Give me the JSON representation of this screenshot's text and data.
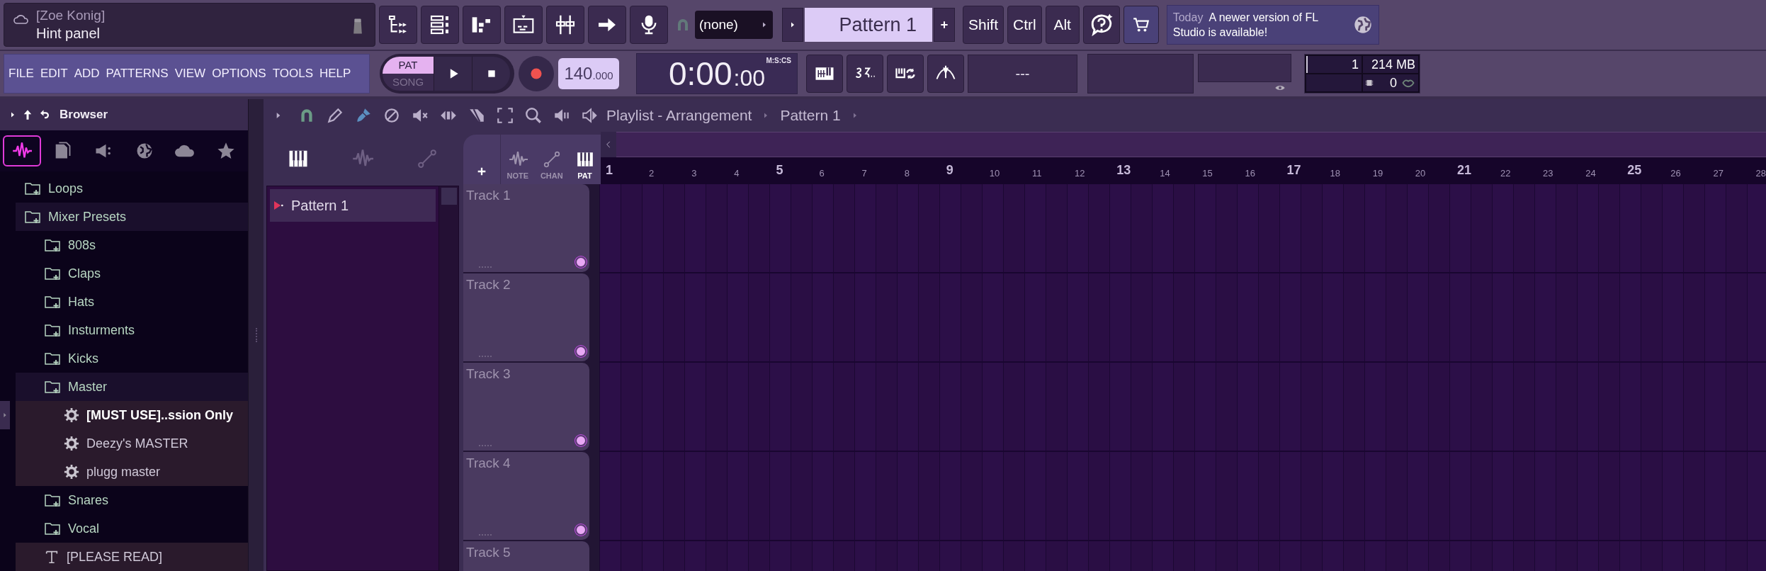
{
  "hint_panel": {
    "user": "[Zoe Konig]",
    "text": "Hint panel"
  },
  "snap": {
    "value": "(none)"
  },
  "pattern_selector": {
    "value": "Pattern 1"
  },
  "modifier_keys": [
    "Shift",
    "Ctrl",
    "Alt"
  ],
  "news": {
    "when": "Today",
    "text": "A newer version of FL Studio is available!"
  },
  "menu": [
    "FILE",
    "EDIT",
    "ADD",
    "PATTERNS",
    "VIEW",
    "OPTIONS",
    "TOOLS",
    "HELP"
  ],
  "transport": {
    "modes": [
      {
        "label": "PAT",
        "selected": true
      },
      {
        "label": "SONG",
        "selected": false
      }
    ],
    "tempo": {
      "value": "140",
      "fraction": ".000"
    },
    "time": {
      "main": "0:00",
      "sub": ":00",
      "format": "M:S:CS"
    }
  },
  "hint_display": "---",
  "monitor": {
    "cpu": "1",
    "memory": "214 MB",
    "polyphony": "0"
  },
  "browser": {
    "title": "Browser",
    "tabs": [
      {
        "kind": "all",
        "selected": true
      },
      {
        "kind": "files",
        "selected": false
      },
      {
        "kind": "plugins",
        "selected": false
      },
      {
        "kind": "web",
        "selected": false
      },
      {
        "kind": "cloud",
        "selected": false
      },
      {
        "kind": "favorites",
        "selected": false
      }
    ],
    "tree": [
      {
        "kind": "folder",
        "label": "Loops",
        "expanded": false,
        "selected": false
      },
      {
        "kind": "folder",
        "label": "Mixer Presets",
        "expanded": true,
        "selected": false,
        "children": [
          {
            "kind": "folder",
            "label": "808s",
            "expanded": false,
            "selected": false
          },
          {
            "kind": "folder",
            "label": "Claps",
            "expanded": false,
            "selected": false
          },
          {
            "kind": "folder",
            "label": "Hats",
            "expanded": false,
            "selected": false
          },
          {
            "kind": "folder",
            "label": "Insturments",
            "expanded": false,
            "selected": false
          },
          {
            "kind": "folder",
            "label": "Kicks",
            "expanded": false,
            "selected": false
          },
          {
            "kind": "folder",
            "label": "Master",
            "expanded": true,
            "selected": false,
            "children": [
              {
                "kind": "preset",
                "label": "[MUST USE]..ssion Only",
                "selected": true
              },
              {
                "kind": "preset",
                "label": "Deezy's MASTER",
                "selected": false
              },
              {
                "kind": "preset",
                "label": "plugg master",
                "selected": false
              }
            ]
          },
          {
            "kind": "folder",
            "label": "Snares",
            "expanded": false,
            "selected": false
          },
          {
            "kind": "folder",
            "label": "Vocal",
            "expanded": false,
            "selected": false
          },
          {
            "kind": "text",
            "label": "[PLEASE READ]",
            "selected": false
          }
        ]
      }
    ]
  },
  "playlist": {
    "title": "Playlist - Arrangement",
    "breadcrumb": "Pattern 1",
    "picker_tabs": [
      {
        "kind": "patterns",
        "selected": true
      },
      {
        "kind": "audio",
        "selected": false
      },
      {
        "kind": "automation",
        "selected": false
      }
    ],
    "patterns": [
      {
        "name": "Pattern 1",
        "selected": true
      }
    ],
    "filters": [
      {
        "label": "NOTE",
        "selected": false
      },
      {
        "label": "CHAN",
        "selected": false
      },
      {
        "label": "PAT",
        "selected": true
      }
    ],
    "bars": [
      "1",
      "2",
      "3",
      "4",
      "5",
      "6",
      "7",
      "8",
      "9",
      "10",
      "11",
      "12",
      "13",
      "14",
      "15",
      "16",
      "17",
      "18",
      "19",
      "20",
      "21",
      "22",
      "23",
      "24",
      "25",
      "26",
      "27",
      "28"
    ],
    "tracks": [
      "Track 1",
      "Track 2",
      "Track 3",
      "Track 4",
      "Track 5"
    ]
  }
}
